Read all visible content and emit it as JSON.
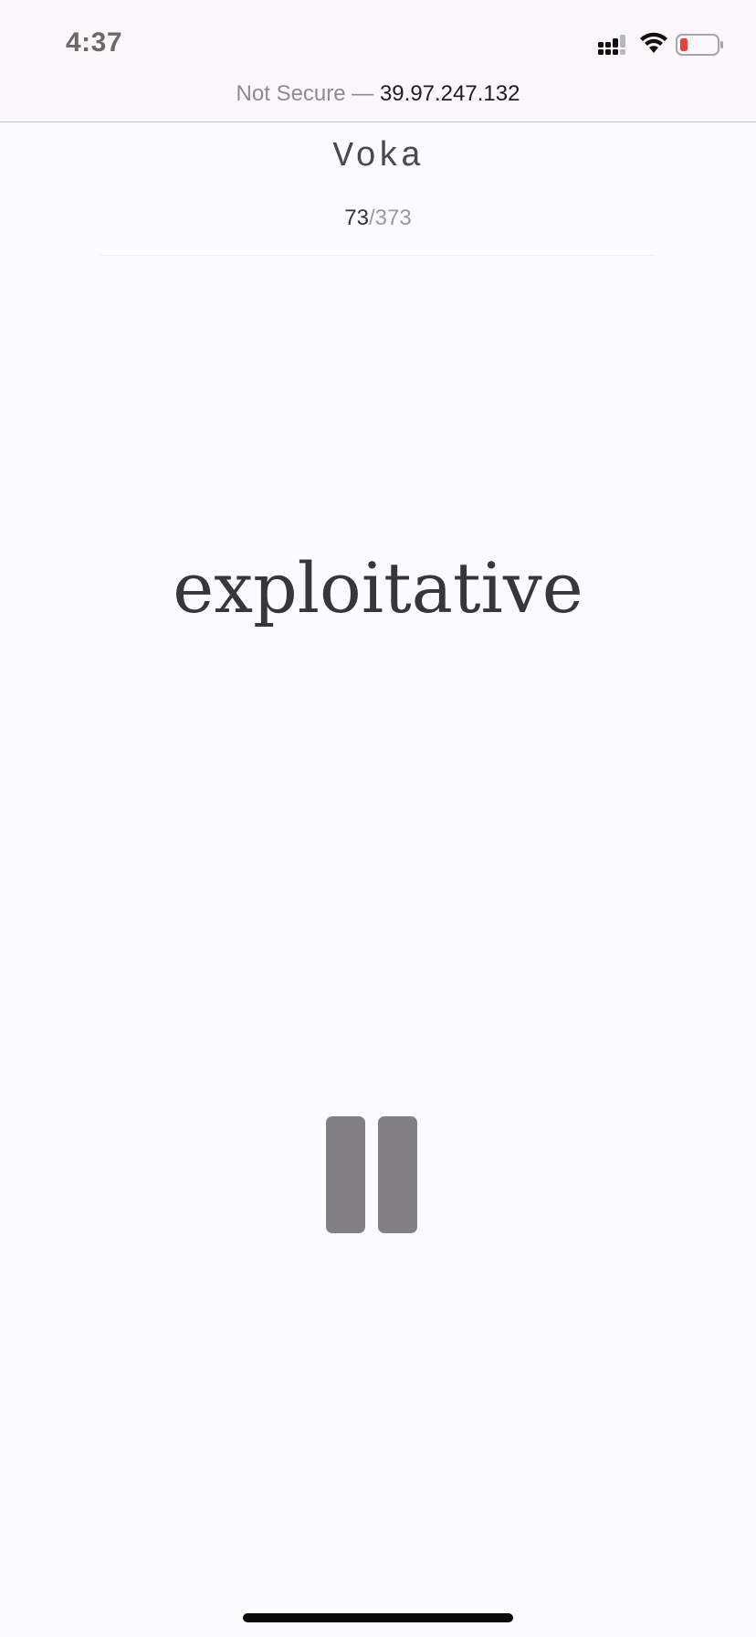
{
  "status_bar": {
    "time": "4:37",
    "icons": [
      "signal-icon",
      "wifi-icon",
      "battery-icon"
    ],
    "battery_color": "#e8403c"
  },
  "address_bar": {
    "security_label": "Not Secure —",
    "host": "39.97.247.132"
  },
  "app": {
    "title": "Voka",
    "progress": {
      "current": "73",
      "separator": "/",
      "total": "373"
    },
    "word": "exploitative",
    "controls": {
      "pause_icon": "pause-icon"
    }
  },
  "colors": {
    "background": "#fcfcfe",
    "word_text": "#38363a",
    "pause_icon": "#828085"
  }
}
